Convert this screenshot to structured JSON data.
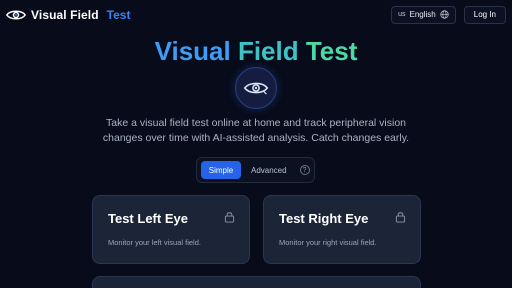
{
  "header": {
    "brand_main": "Visual Field",
    "brand_accent": "Test",
    "brand_icon": "eye-logo-icon",
    "language_code": "us",
    "language_label": "English",
    "language_icon": "globe-icon",
    "login_label": "Log In"
  },
  "hero": {
    "title_word1": "Visual",
    "title_word2": "Field",
    "title_word3": "Test",
    "icon": "eye-icon",
    "tagline": "Take a visual field test online at home and track peripheral vision changes over time with AI-assisted analysis. Catch changes early."
  },
  "mode_toggle": {
    "simple_label": "Simple",
    "advanced_label": "Advanced",
    "help_glyph": "?",
    "selected": "Simple"
  },
  "cards": {
    "left": {
      "title": "Test Left Eye",
      "description": "Monitor your left visual field.",
      "icon": "lock-icon"
    },
    "right": {
      "title": "Test Right Eye",
      "description": "Monitor your right visual field.",
      "icon": "lock-icon"
    }
  },
  "colors": {
    "background": "#070b1a",
    "accent_blue": "#3b82f6",
    "button_primary": "#2563eb",
    "card_bg": "#1c2538",
    "gradient_start": "#3f9bf4",
    "gradient_end": "#4cd9a6"
  }
}
